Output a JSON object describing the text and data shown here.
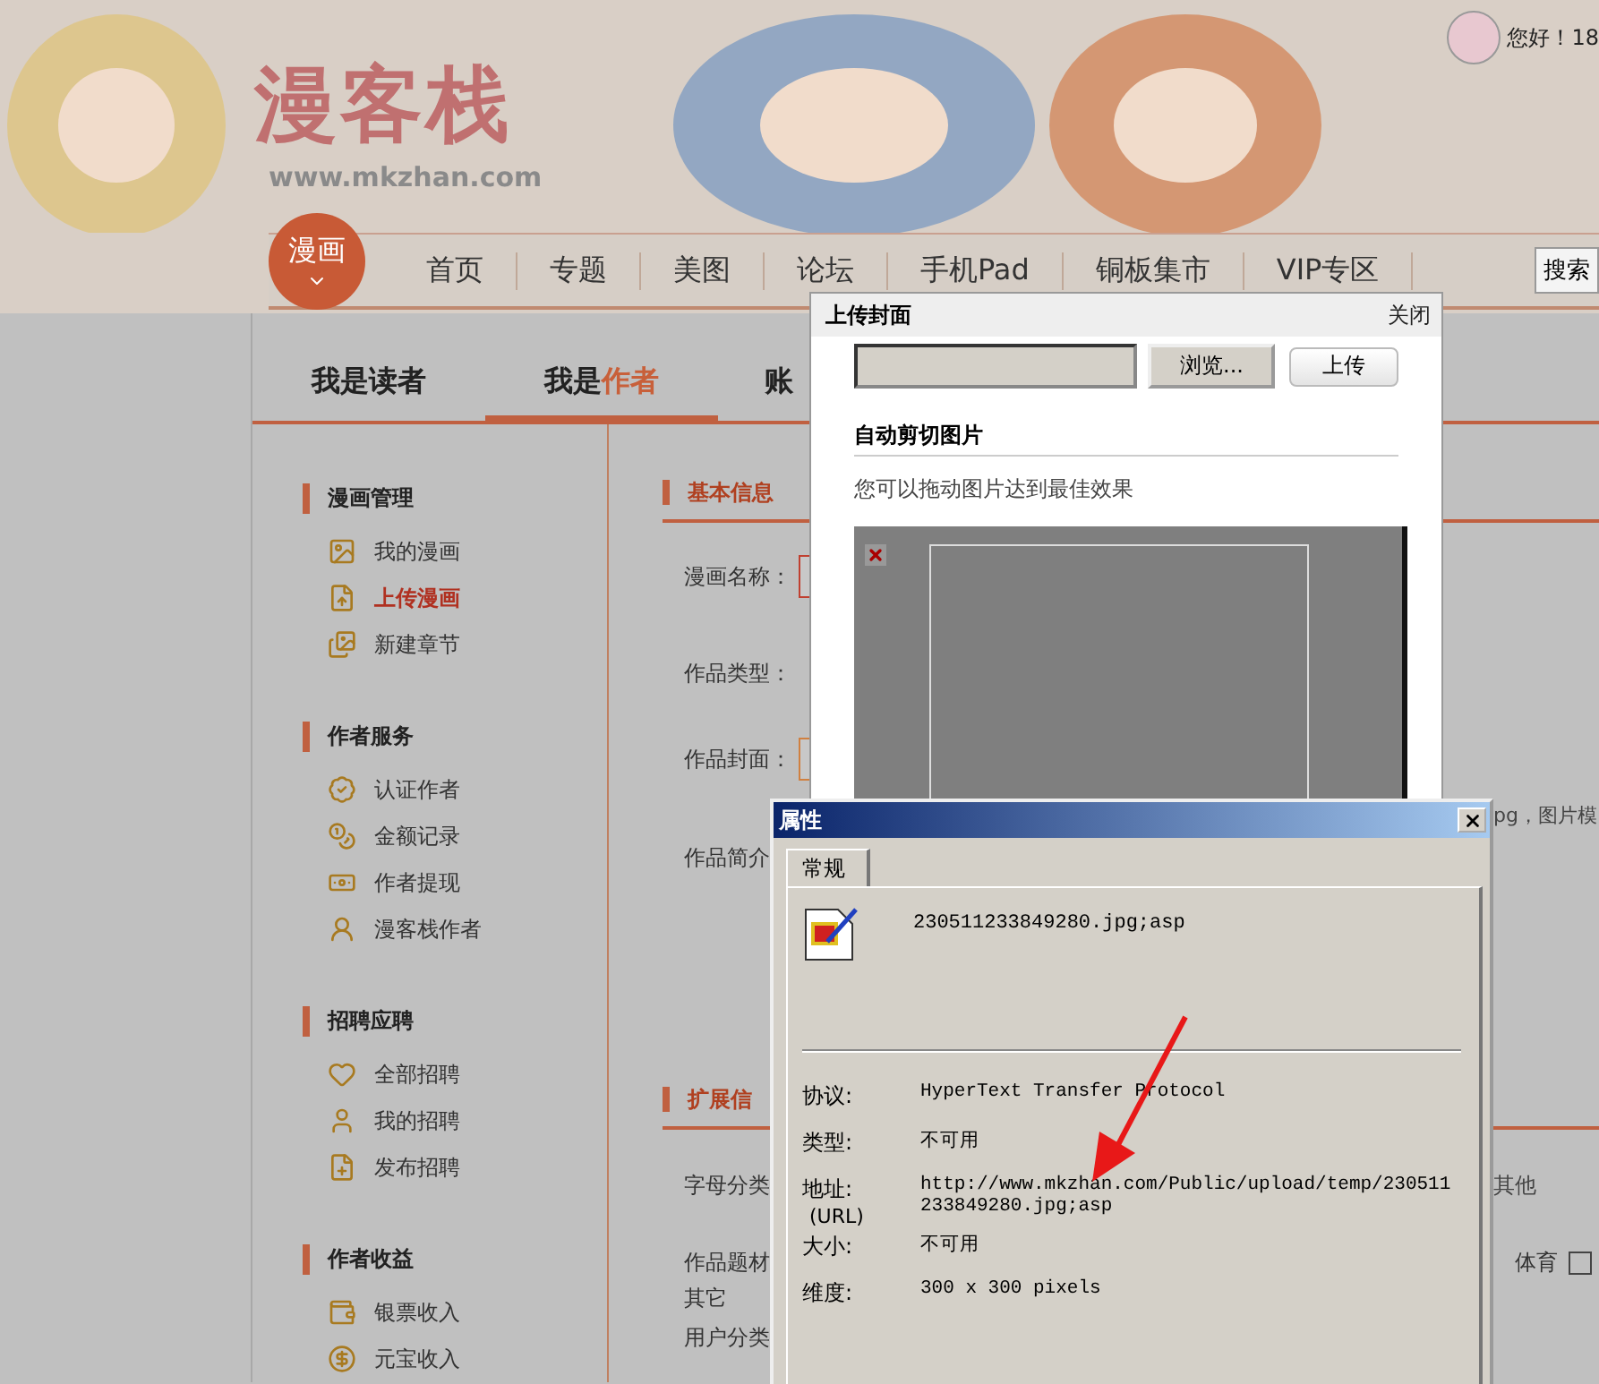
{
  "header": {
    "logo": "漫客栈",
    "logo_url": "www.mkzhan.com",
    "greeting": "您好！18",
    "nav_badge": "漫画",
    "nav": [
      "首页",
      "专题",
      "美图",
      "论坛",
      "手机Pad",
      "铜板集市",
      "VIP专区"
    ],
    "search": "搜索"
  },
  "tabs": [
    {
      "label": "我是读者",
      "selected": false
    },
    {
      "label": "我是**作者**",
      "selected": true
    },
    {
      "label": "账",
      "selected": false
    }
  ],
  "sidebar": [
    {
      "title": "漫画管理",
      "items": [
        {
          "label": "我的漫画",
          "selected": false
        },
        {
          "label": "上传漫画",
          "selected": true
        },
        {
          "label": "新建章节",
          "selected": false
        }
      ]
    },
    {
      "title": "作者服务",
      "items": [
        {
          "label": "认证作者",
          "selected": false
        },
        {
          "label": "金额记录",
          "selected": false
        },
        {
          "label": "作者提现",
          "selected": false
        },
        {
          "label": "漫客栈作者",
          "selected": false
        }
      ]
    },
    {
      "title": "招聘应聘",
      "items": [
        {
          "label": "全部招聘",
          "selected": false
        },
        {
          "label": "我的招聘",
          "selected": false
        },
        {
          "label": "发布招聘",
          "selected": false
        }
      ]
    },
    {
      "title": "作者收益",
      "items": [
        {
          "label": "银票收入",
          "selected": false
        },
        {
          "label": "元宝收入",
          "selected": false
        }
      ]
    }
  ],
  "basic_info": {
    "title": "基本信息",
    "name_label": "漫画名称：",
    "type_label": "作品类型：",
    "cover_label": "作品封面：",
    "cover_hint": "pg，图片模",
    "intro_label": "作品简介"
  },
  "extended_info": {
    "title": "扩展信",
    "letter_label": "字母分类",
    "letter_option": "其他",
    "genre_label": "作品题材",
    "genre_other": "其它",
    "genre_option": {
      "label": "体育",
      "checked": false
    },
    "user_label": "用户分类"
  },
  "upload_dialog": {
    "title": "上传封面",
    "close": "关闭",
    "browse": "浏览...",
    "upload": "上传",
    "section_title": "自动剪切图片",
    "hint": "您可以拖动图片达到最佳效果"
  },
  "properties_dialog": {
    "title": "属性",
    "tabs": [
      {
        "label": "常规",
        "selected": true
      }
    ],
    "filename": "230511233849280.jpg;asp",
    "rows": [
      {
        "label": "协议:",
        "value": "HyperText Transfer Protocol"
      },
      {
        "label": "类型:",
        "value": "不可用"
      },
      {
        "label": "地址:",
        "sublabel": "(URL)",
        "value": "http://www.mkzhan.com/Public/upload/temp/230511233849280.jpg;asp"
      },
      {
        "label": "大小:",
        "value": "不可用"
      },
      {
        "label": "维度:",
        "value": "300  x  300  pixels"
      }
    ]
  }
}
